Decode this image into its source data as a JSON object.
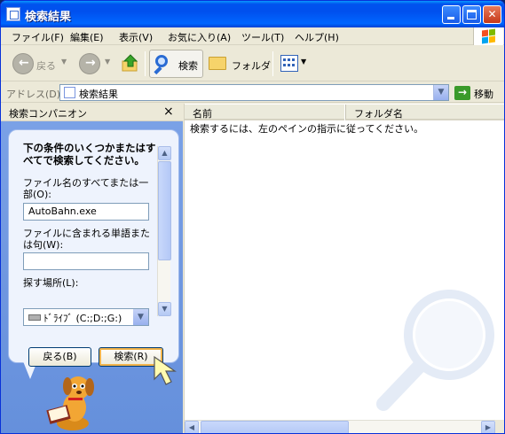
{
  "window": {
    "title": "検索結果",
    "colors": {
      "titlebar": "#0053ee",
      "close": "#c5391a",
      "pane": "#7ba2e7"
    }
  },
  "menu": {
    "items": [
      "ファイル(F)",
      "編集(E)",
      "表示(V)",
      "お気に入り(A)",
      "ツール(T)",
      "ヘルプ(H)"
    ]
  },
  "toolbar": {
    "back_label": "戻る",
    "search_label": "検索",
    "folders_label": "フォルダ",
    "icons": [
      "back-arrow-icon",
      "forward-arrow-icon",
      "up-folder-icon",
      "search-icon",
      "folder-icon",
      "views-icon"
    ]
  },
  "address": {
    "label": "アドレス(D)",
    "value": "検索結果",
    "go_label": "移動"
  },
  "companion": {
    "title": "検索コンパニオン",
    "close_glyph": "×",
    "heading": "下の条件のいくつかまたはすべてで検索してください。",
    "filename_label": "ファイル名のすべてまたは一部(O):",
    "filename_value": "AutoBahn.exe",
    "phrase_label": "ファイルに含まれる単語または句(W):",
    "phrase_value": "",
    "location_label": "探す場所(L):",
    "location_value": "ﾄﾞﾗｲﾌﾞ (C:;D:;G:)",
    "back_button": "戻る(B)",
    "search_button": "検索(R)"
  },
  "results": {
    "columns": [
      "名前",
      "フォルダ名"
    ],
    "hint": "検索するには、左のペインの指示に従ってください。"
  }
}
